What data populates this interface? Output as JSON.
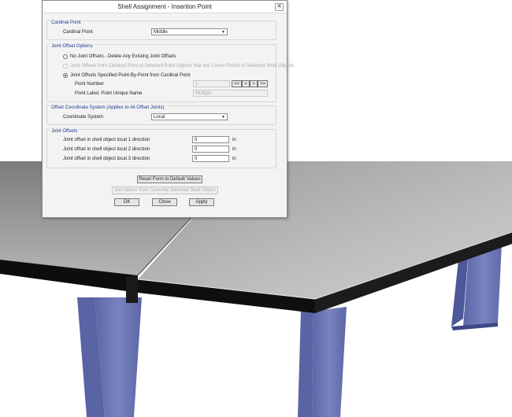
{
  "dialog": {
    "title": "Shell Assignment - Insertion Point",
    "close_icon": "close-icon",
    "cardinal": {
      "group_title": "Cardinal Point",
      "label": "Cardinal Point",
      "value": "Middle"
    },
    "joint_options": {
      "group_title": "Joint Offset Options",
      "option1": "No Joint Offsets - Delete Any Existing Joint Offsets",
      "option2": "Joint Offsets from Cardinal Point at Selected Point Objects that are Corner Points of Selected Shell Objects",
      "option3": "Joint Offsets Specified Point-By-Point from Cardinal Point",
      "selected_option": 3,
      "point_number_label": "Point Number",
      "point_number_value": "1",
      "nav_first": "<<",
      "nav_prev": "<",
      "nav_next": ">",
      "nav_last": ">>",
      "point_label_label": "Point Label;  Point Unique Name",
      "point_label_value": "Multiple"
    },
    "coord_system": {
      "group_title": "Offset Coordinate System  (Applies to All Offset Joints)",
      "label": "Coordinate System",
      "value": "Local"
    },
    "joint_offsets": {
      "group_title": "Joint Offsets",
      "rows": [
        {
          "label": "Joint offset in shell object local 1 direction",
          "value": "0",
          "unit": "in"
        },
        {
          "label": "Joint offset in shell object local 2 direction",
          "value": "0",
          "unit": "in"
        },
        {
          "label": "Joint offset in shell object local 3 direction",
          "value": "0",
          "unit": "in"
        }
      ]
    },
    "buttons": {
      "reset": "Reset Form to Default Values",
      "get_values": "Get Values from Currently Selected Shell Object",
      "ok": "OK",
      "close": "Close",
      "apply": "Apply"
    }
  },
  "colors": {
    "group_title": "#1c3a8f",
    "column_fill": "#6f78b4",
    "slab_top": "#6e6e6e",
    "slab_edge": "#101010"
  }
}
